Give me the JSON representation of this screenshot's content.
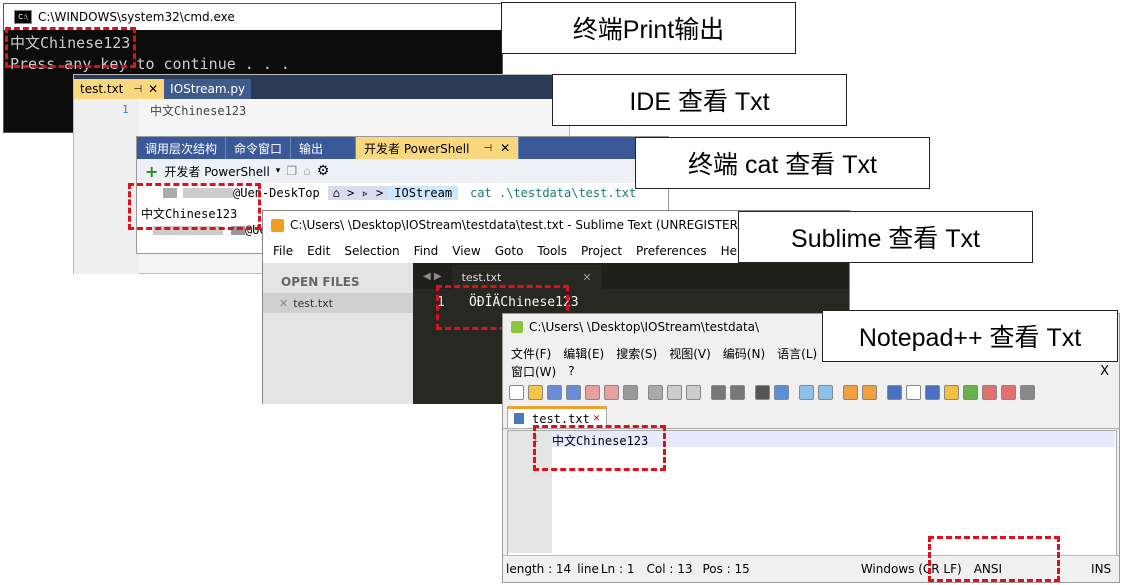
{
  "labels": {
    "print": "终端Print输出",
    "ide": "IDE 查看 Txt",
    "cat": "终端 cat 查看 Txt",
    "sublime": "Sublime 查看 Txt",
    "notepad": "Notepad++ 查看 Txt"
  },
  "cmd": {
    "title": "C:\\WINDOWS\\system32\\cmd.exe",
    "lines": [
      "中文Chinese123",
      "Press any key to continue . . ."
    ]
  },
  "ide": {
    "tabs": [
      "test.txt",
      "IOStream.py"
    ],
    "line_number": "1",
    "content": "中文Chinese123"
  },
  "powershell": {
    "tabs": [
      "调用层次结构",
      "命令窗口",
      "输出",
      "开发者 PowerShell"
    ],
    "toolbar_label": "开发者 PowerShell",
    "prompt_host": "@Uen-DeskTop",
    "prompt_dir": "IOStream",
    "command": "cat .\\testdata\\test.txt",
    "output": "中文Chinese123",
    "prompt_host2": "@Uen"
  },
  "sublime": {
    "title": "C:\\Users\\ \\Desktop\\IOStream\\testdata\\test.txt - Sublime Text (UNREGISTERED)",
    "menu": [
      "File",
      "Edit",
      "Selection",
      "Find",
      "View",
      "Goto",
      "Tools",
      "Project",
      "Preferences",
      "Help"
    ],
    "open_files_label": "OPEN FILES",
    "file": "test.txt",
    "tab": "test.txt",
    "line_number": "1",
    "content": "ÖÐÎÄChinese123"
  },
  "notepad": {
    "title": "C:\\Users\\ \\Desktop\\IOStream\\testdata\\",
    "menu": [
      "文件(F)",
      "编辑(E)",
      "搜索(S)",
      "视图(V)",
      "编码(N)",
      "语言(L)"
    ],
    "menu2": [
      "窗口(W)",
      "?"
    ],
    "close": "X",
    "tab": "test.txt",
    "line_number": "1",
    "content": "中文Chinese123",
    "status": {
      "length": "length : 14",
      "line_prefix": "line",
      "ln": "Ln : 1",
      "col": "Col : 13",
      "pos": "Pos : 15",
      "eol": "Windows (CR LF)",
      "encoding": "ANSI",
      "mode": "INS"
    }
  }
}
